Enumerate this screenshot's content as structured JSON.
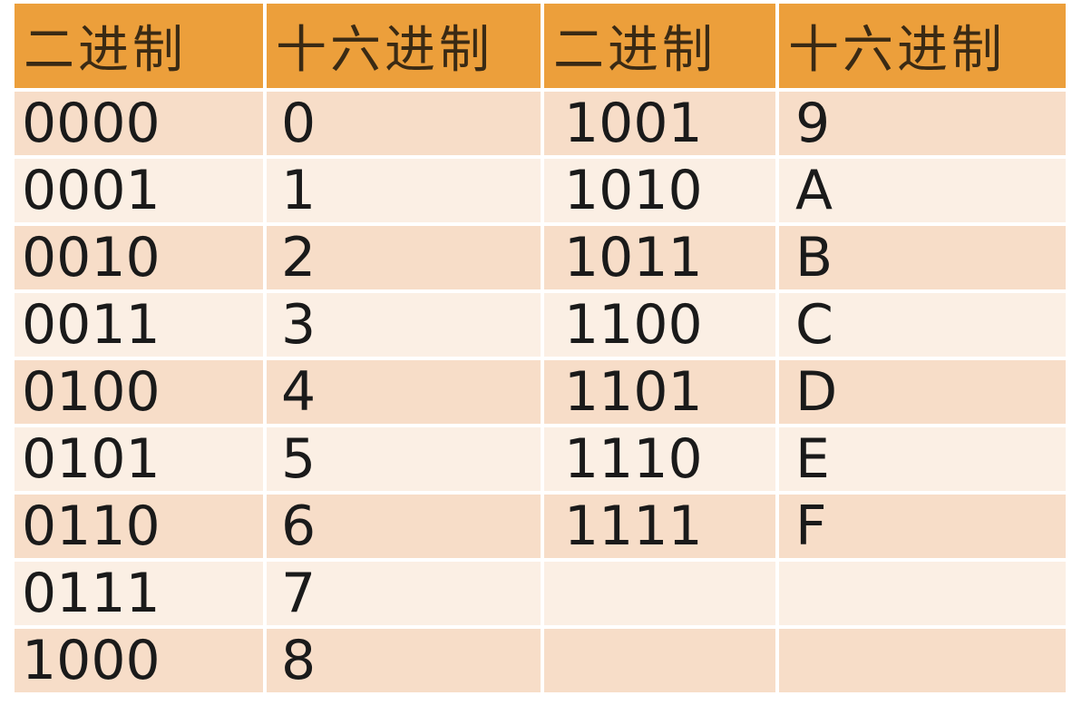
{
  "headers": [
    "二进制",
    "十六进制",
    "二进制",
    "十六进制"
  ],
  "rows": [
    [
      "0000",
      "0",
      "1001",
      "9"
    ],
    [
      "0001",
      "1",
      "1010",
      "A"
    ],
    [
      "0010",
      "2",
      "1011",
      "B"
    ],
    [
      "0011",
      "3",
      "1100",
      "C"
    ],
    [
      "0100",
      "4",
      "1101",
      "D"
    ],
    [
      "0101",
      "5",
      "1110",
      "E"
    ],
    [
      "0110",
      "6",
      "1111",
      "F"
    ],
    [
      "0111",
      "7",
      "",
      ""
    ],
    [
      "1000",
      "8",
      "",
      ""
    ]
  ],
  "colors": {
    "header_bg": "#ec9f3b",
    "row_odd_bg": "#f7ddc8",
    "row_even_bg": "#fbefe4"
  }
}
